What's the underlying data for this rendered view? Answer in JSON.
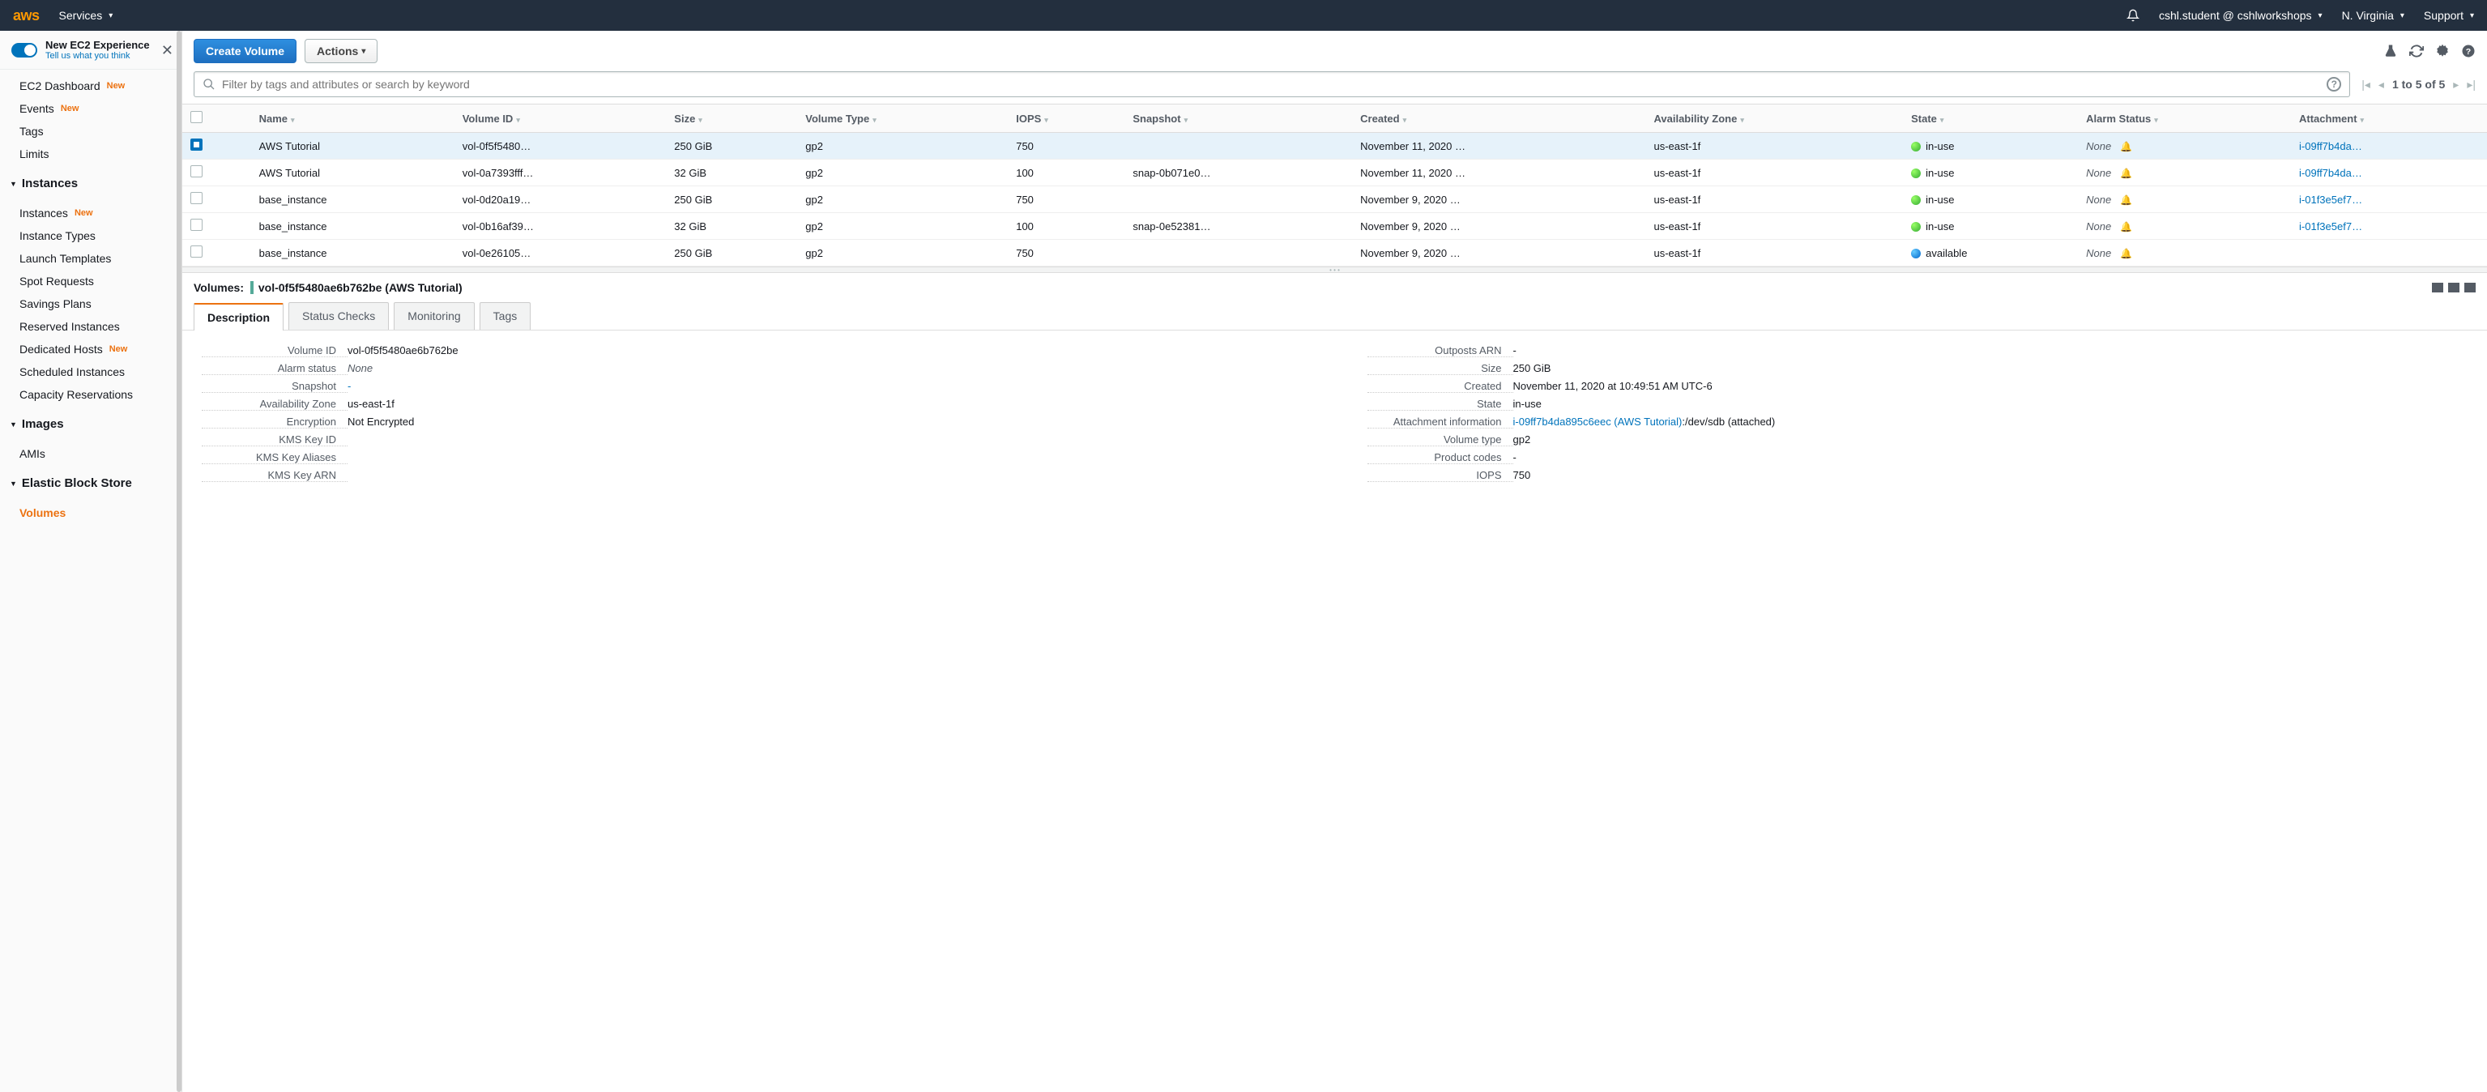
{
  "topnav": {
    "services": "Services",
    "account": "cshl.student @ cshlworkshops",
    "region": "N. Virginia",
    "support": "Support"
  },
  "new_experience": {
    "title": "New EC2 Experience",
    "subtitle": "Tell us what you think"
  },
  "sidebar": {
    "top": [
      {
        "label": "EC2 Dashboard",
        "new": true
      },
      {
        "label": "Events",
        "new": true
      },
      {
        "label": "Tags",
        "new": false
      },
      {
        "label": "Limits",
        "new": false
      }
    ],
    "sections": [
      {
        "title": "Instances",
        "items": [
          {
            "label": "Instances",
            "new": true
          },
          {
            "label": "Instance Types",
            "new": false
          },
          {
            "label": "Launch Templates",
            "new": false
          },
          {
            "label": "Spot Requests",
            "new": false
          },
          {
            "label": "Savings Plans",
            "new": false
          },
          {
            "label": "Reserved Instances",
            "new": false
          },
          {
            "label": "Dedicated Hosts",
            "new": true
          },
          {
            "label": "Scheduled Instances",
            "new": false
          },
          {
            "label": "Capacity Reservations",
            "new": false
          }
        ]
      },
      {
        "title": "Images",
        "items": [
          {
            "label": "AMIs",
            "new": false
          }
        ]
      },
      {
        "title": "Elastic Block Store",
        "items": [
          {
            "label": "Volumes",
            "new": false,
            "active": true
          }
        ]
      }
    ]
  },
  "toolbar": {
    "create": "Create Volume",
    "actions": "Actions"
  },
  "filter": {
    "placeholder": "Filter by tags and attributes or search by keyword"
  },
  "pagination": {
    "text": "1 to 5 of 5"
  },
  "columns": [
    "Name",
    "Volume ID",
    "Size",
    "Volume Type",
    "IOPS",
    "Snapshot",
    "Created",
    "Availability Zone",
    "State",
    "Alarm Status",
    "Attachment"
  ],
  "rows": [
    {
      "selected": true,
      "name": "AWS Tutorial",
      "volume_id": "vol-0f5f5480…",
      "size": "250 GiB",
      "type": "gp2",
      "iops": "750",
      "snapshot": "",
      "created": "November 11, 2020 …",
      "az": "us-east-1f",
      "state": "in-use",
      "state_color": "green",
      "alarm": "None",
      "attachment": "i-09ff7b4da…"
    },
    {
      "selected": false,
      "name": "AWS Tutorial",
      "volume_id": "vol-0a7393fff…",
      "size": "32 GiB",
      "type": "gp2",
      "iops": "100",
      "snapshot": "snap-0b071e0…",
      "created": "November 11, 2020 …",
      "az": "us-east-1f",
      "state": "in-use",
      "state_color": "green",
      "alarm": "None",
      "attachment": "i-09ff7b4da…"
    },
    {
      "selected": false,
      "name": "base_instance",
      "volume_id": "vol-0d20a19…",
      "size": "250 GiB",
      "type": "gp2",
      "iops": "750",
      "snapshot": "",
      "created": "November 9, 2020 …",
      "az": "us-east-1f",
      "state": "in-use",
      "state_color": "green",
      "alarm": "None",
      "attachment": "i-01f3e5ef7…"
    },
    {
      "selected": false,
      "name": "base_instance",
      "volume_id": "vol-0b16af39…",
      "size": "32 GiB",
      "type": "gp2",
      "iops": "100",
      "snapshot": "snap-0e52381…",
      "created": "November 9, 2020 …",
      "az": "us-east-1f",
      "state": "in-use",
      "state_color": "green",
      "alarm": "None",
      "attachment": "i-01f3e5ef7…"
    },
    {
      "selected": false,
      "name": "base_instance",
      "volume_id": "vol-0e26105…",
      "size": "250 GiB",
      "type": "gp2",
      "iops": "750",
      "snapshot": "",
      "created": "November 9, 2020 …",
      "az": "us-east-1f",
      "state": "available",
      "state_color": "blue",
      "alarm": "None",
      "attachment": ""
    }
  ],
  "detail": {
    "header_prefix": "Volumes:",
    "header_id": "vol-0f5f5480ae6b762be (AWS Tutorial)",
    "tabs": [
      "Description",
      "Status Checks",
      "Monitoring",
      "Tags"
    ],
    "left": [
      {
        "label": "Volume ID",
        "value": "vol-0f5f5480ae6b762be"
      },
      {
        "label": "Alarm status",
        "value": "None",
        "italic": true
      },
      {
        "label": "Snapshot",
        "value": "-",
        "link": true
      },
      {
        "label": "Availability Zone",
        "value": "us-east-1f"
      },
      {
        "label": "Encryption",
        "value": "Not Encrypted"
      },
      {
        "label": "KMS Key ID",
        "value": ""
      },
      {
        "label": "KMS Key Aliases",
        "value": ""
      },
      {
        "label": "KMS Key ARN",
        "value": ""
      }
    ],
    "right": [
      {
        "label": "Outposts ARN",
        "value": "-"
      },
      {
        "label": "Size",
        "value": "250 GiB"
      },
      {
        "label": "Created",
        "value": "November 11, 2020 at 10:49:51 AM UTC-6"
      },
      {
        "label": "State",
        "value": "in-use"
      },
      {
        "label": "Attachment information",
        "value": "i-09ff7b4da895c6eec (AWS Tutorial)",
        "suffix": ":/dev/sdb (attached)",
        "link": true
      },
      {
        "label": "Volume type",
        "value": "gp2"
      },
      {
        "label": "Product codes",
        "value": "-"
      },
      {
        "label": "IOPS",
        "value": "750"
      }
    ]
  }
}
